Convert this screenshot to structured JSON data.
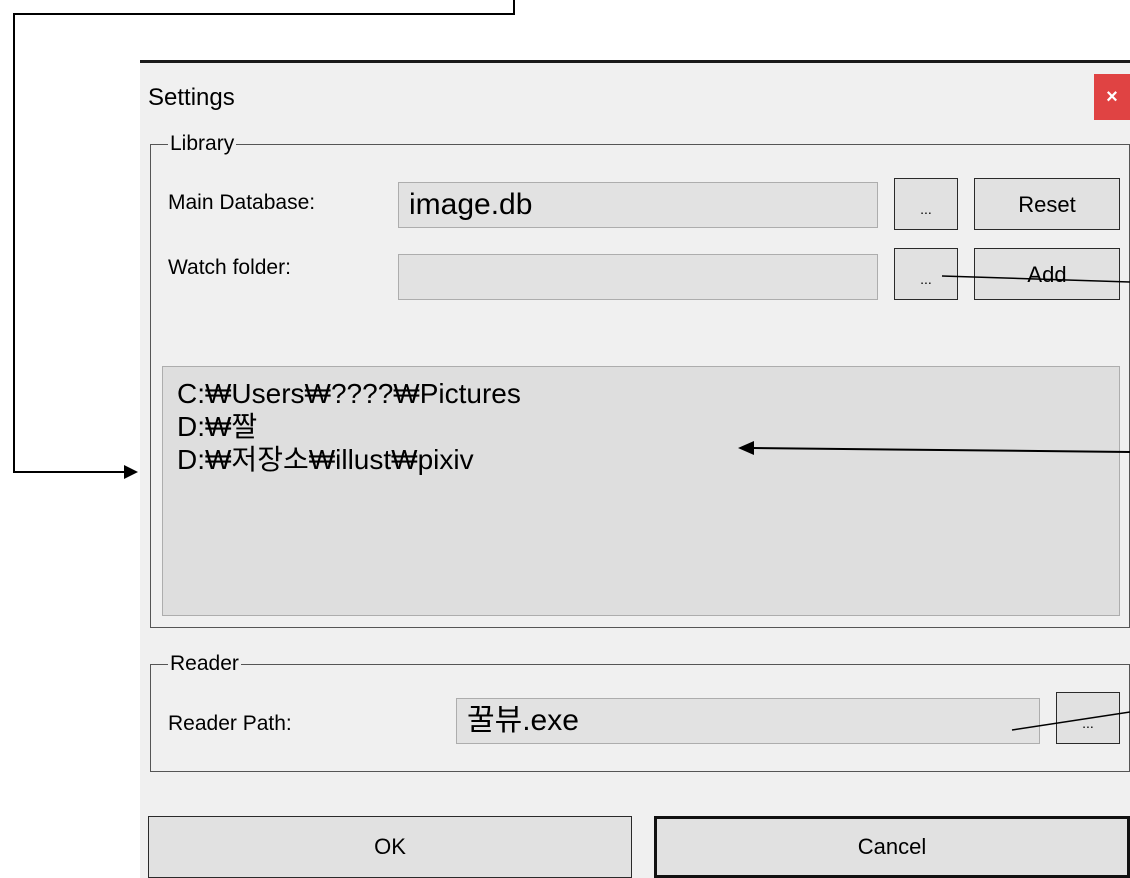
{
  "dialog": {
    "title": "Settings",
    "close_glyph": "×"
  },
  "library": {
    "group_label": "Library",
    "main_database_label": "Main Database:",
    "main_database_value": "image.db",
    "browse_label": "...",
    "reset_label": "Reset",
    "watch_folder_label": "Watch folder:",
    "watch_folder_value": "",
    "add_label": "Add",
    "folders": [
      "C:₩Users₩????₩Pictures",
      "D:₩짤",
      "D:₩저장소₩illust₩pixiv"
    ]
  },
  "reader": {
    "group_label": "Reader",
    "path_label": "Reader Path:",
    "path_value": "꿀뷰.exe",
    "browse_label": "..."
  },
  "footer": {
    "ok_label": "OK",
    "cancel_label": "Cancel"
  }
}
